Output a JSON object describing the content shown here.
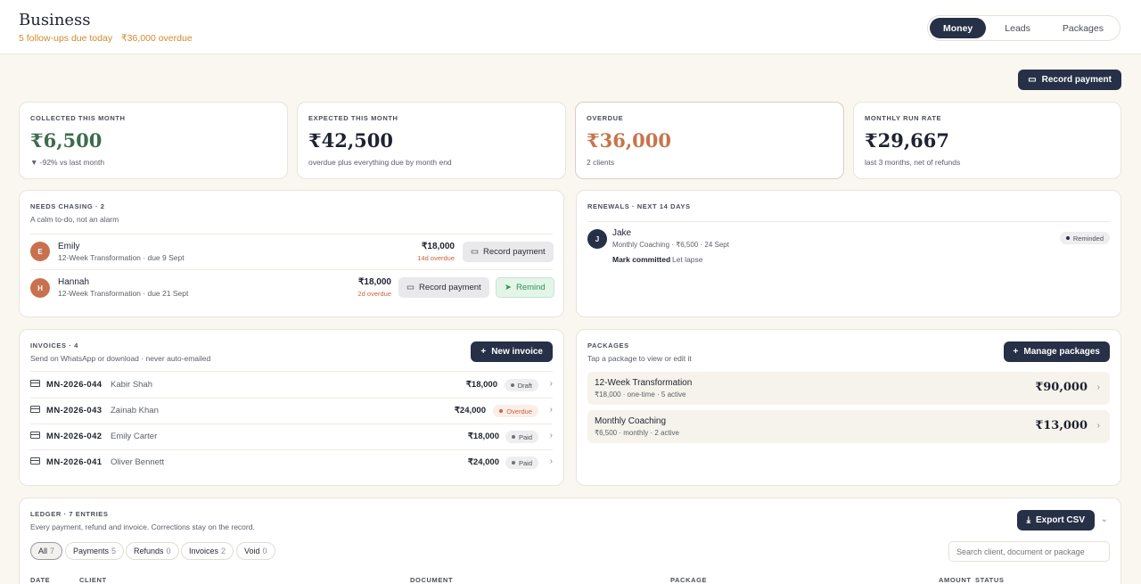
{
  "header": {
    "title": "Business",
    "followups": "5 follow-ups due today",
    "overdue": "₹36,000 overdue",
    "tabs": [
      "Money",
      "Leads",
      "Packages"
    ]
  },
  "actions": {
    "record_payment": "Record payment"
  },
  "stats": [
    {
      "label": "COLLECTED THIS MONTH",
      "value": "₹6,500",
      "sub": "▼ -92% vs last month",
      "color": "#3e6b4f"
    },
    {
      "label": "EXPECTED THIS MONTH",
      "value": "₹42,500",
      "sub": "overdue plus everything due by month end",
      "color": "#1f2230"
    },
    {
      "label": "OVERDUE",
      "value": "₹36,000",
      "sub": "2 clients",
      "color": "#c8744a"
    },
    {
      "label": "MONTHLY RUN RATE",
      "value": "₹29,667",
      "sub": "last 3 months, net of refunds",
      "color": "#1f2230"
    }
  ],
  "chasing": {
    "title": "NEEDS CHASING · 2",
    "sub": "A calm to-do, not an alarm",
    "rows": [
      {
        "initial": "E",
        "name": "Emily",
        "meta": "12-Week Transformation · due 9 Sept",
        "amount": "₹18,000",
        "overdue": "14d overdue",
        "record": "Record payment"
      },
      {
        "initial": "H",
        "name": "Hannah",
        "meta": "12-Week Transformation · due 21 Sept",
        "amount": "₹18,000",
        "overdue": "2d overdue",
        "record": "Record payment",
        "remind": "Remind"
      }
    ]
  },
  "renewals": {
    "title": "RENEWALS · NEXT 14 DAYS",
    "row": {
      "initial": "J",
      "name": "Jake",
      "meta": "Monthly Coaching · ₹6,500 · 24 Sept",
      "badge": "Reminded",
      "committed": "Mark committed",
      "lapse": "Let lapse"
    }
  },
  "invoices": {
    "title": "INVOICES · 4",
    "sub": "Send on WhatsApp or download · never auto-emailed",
    "new_label": "New invoice",
    "rows": [
      {
        "no": "MN-2026-044",
        "client": "Kabir Shah",
        "amount": "₹18,000",
        "status": "Draft"
      },
      {
        "no": "MN-2026-043",
        "client": "Zainab Khan",
        "amount": "₹24,000",
        "status": "Overdue"
      },
      {
        "no": "MN-2026-042",
        "client": "Emily Carter",
        "amount": "₹18,000",
        "status": "Paid"
      },
      {
        "no": "MN-2026-041",
        "client": "Oliver Bennett",
        "amount": "₹24,000",
        "status": "Paid"
      }
    ]
  },
  "packages": {
    "title": "PACKAGES",
    "sub": "Tap a package to view or edit it",
    "manage_label": "Manage packages",
    "rows": [
      {
        "name": "12-Week Transformation",
        "meta": "₹18,000 · one-time · 5 active",
        "total": "₹90,000"
      },
      {
        "name": "Monthly Coaching",
        "meta": "₹6,500 · monthly · 2 active",
        "total": "₹13,000"
      }
    ]
  },
  "ledger": {
    "title": "LEDGER · 7 ENTRIES",
    "sub": "Every payment, refund and invoice. Corrections stay on the record.",
    "export_label": "Export CSV",
    "filters": [
      {
        "label": "All",
        "count": "7"
      },
      {
        "label": "Payments",
        "count": "5"
      },
      {
        "label": "Refunds",
        "count": "0"
      },
      {
        "label": "Invoices",
        "count": "2"
      },
      {
        "label": "Void",
        "count": "0"
      }
    ],
    "search_placeholder": "Search client, document or package",
    "columns": [
      "DATE",
      "CLIENT",
      "DOCUMENT",
      "PACKAGE",
      "AMOUNT",
      "STATUS"
    ]
  }
}
